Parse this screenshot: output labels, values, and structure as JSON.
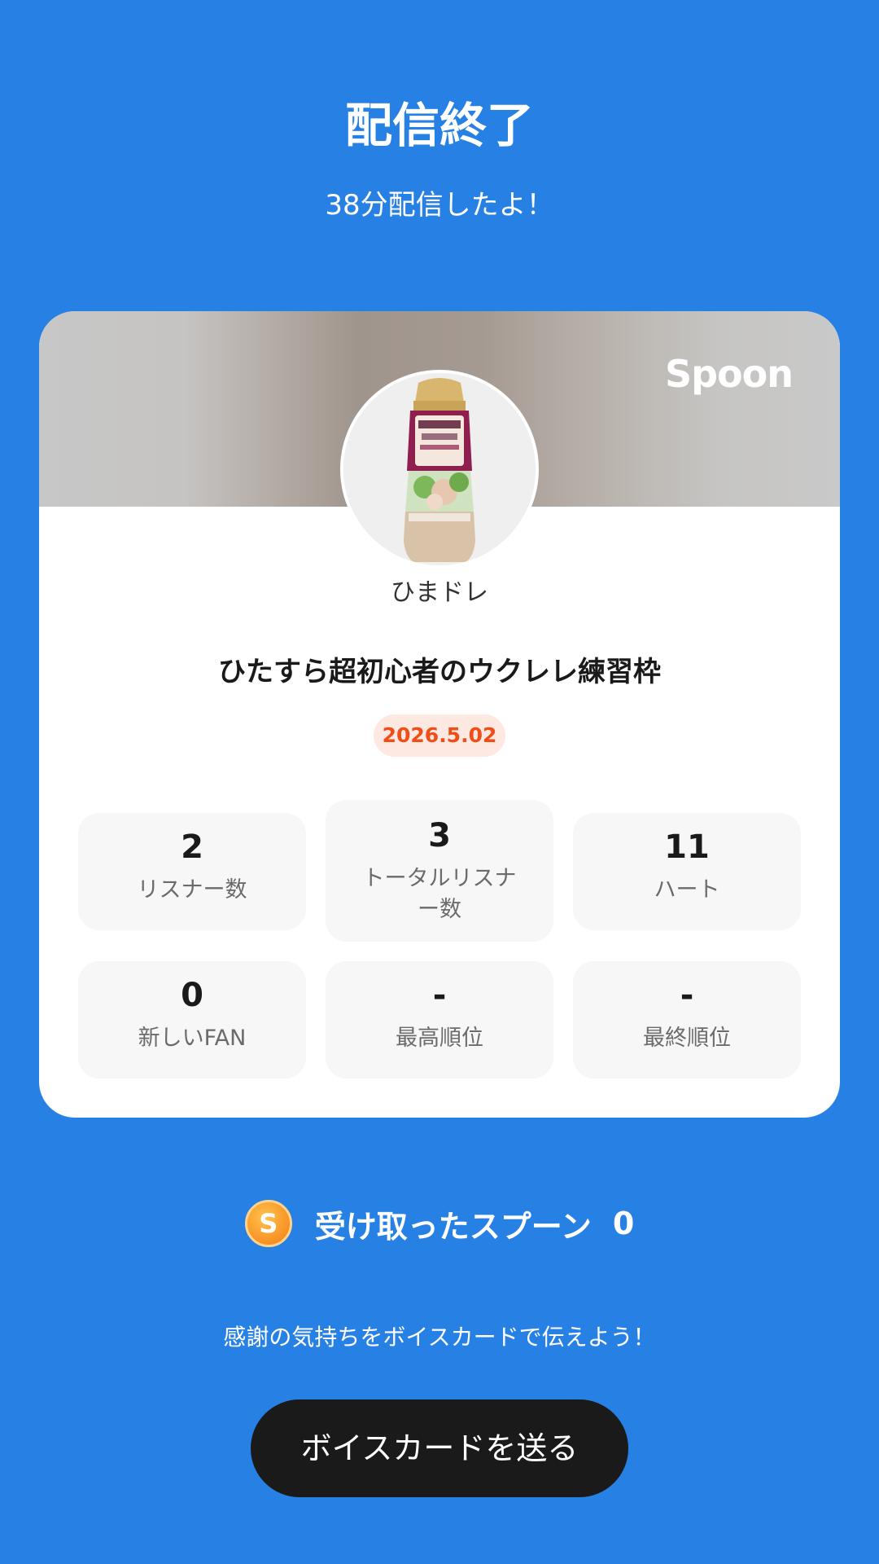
{
  "header": {
    "title": "配信終了",
    "subtitle": "38分配信したよ！"
  },
  "card": {
    "brand": "Spoon",
    "avatar_icon": "dressing-bottle-avatar",
    "username": "ひまドレ",
    "stream_title": "ひたすら超初心者のウクレレ練習枠",
    "date": "2026.5.02",
    "stats": [
      {
        "value": "2",
        "label": "リスナー数"
      },
      {
        "value": "3",
        "label": "トータルリスナー数"
      },
      {
        "value": "11",
        "label": "ハート"
      },
      {
        "value": "0",
        "label": "新しいFAN"
      },
      {
        "value": "-",
        "label": "最高順位"
      },
      {
        "value": "-",
        "label": "最終順位"
      }
    ]
  },
  "spoons": {
    "icon": "spoon-coin-icon",
    "icon_letter": "S",
    "label": "受け取ったスプーン",
    "count": "0"
  },
  "thanks_text": "感謝の気持ちをボイスカードで伝えよう！",
  "send_button_label": "ボイスカードを送る",
  "colors": {
    "background": "#2780E3",
    "date_text": "#F04D17",
    "date_bg": "#FDE8E2",
    "button_bg": "#1A1A1A",
    "spoon_coin": "#F9982A"
  }
}
